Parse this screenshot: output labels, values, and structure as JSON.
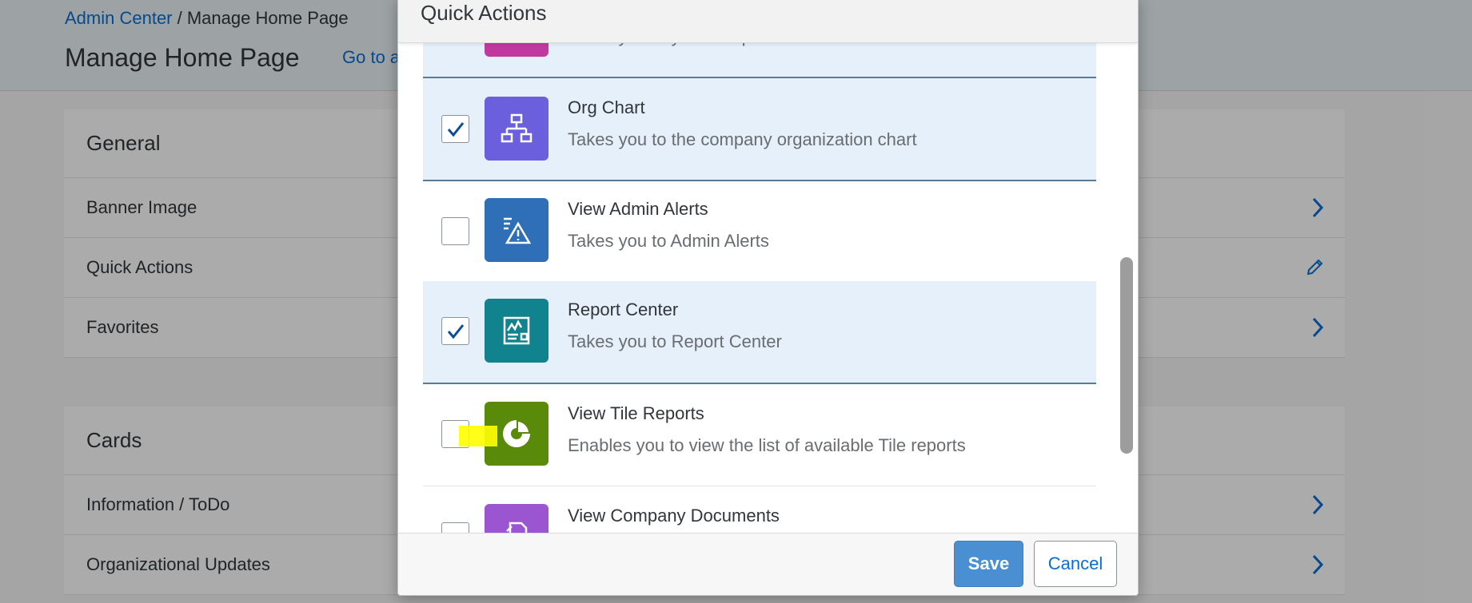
{
  "background": {
    "breadcrumb": {
      "root": "Admin Center",
      "separator": " / ",
      "current": "Manage Home Page"
    },
    "page_title": "Manage Home Page",
    "goto_link": "Go to a",
    "general": {
      "title": "General",
      "rows": [
        {
          "label": "Banner Image",
          "icon": "chevron-right-icon"
        },
        {
          "label": "Quick Actions",
          "icon": "pencil-icon"
        },
        {
          "label": "Favorites",
          "icon": "chevron-right-icon"
        }
      ]
    },
    "cards": {
      "title": "Cards",
      "rows": [
        {
          "label": "Information / ToDo",
          "icon": "chevron-right-icon"
        },
        {
          "label": "Organizational Updates",
          "icon": "chevron-right-icon"
        }
      ]
    }
  },
  "dialog": {
    "title": "Quick Actions",
    "items": [
      {
        "title": "",
        "description": "Takes you to your People Profile",
        "checked": true,
        "icon": "people-profile-icon",
        "color": "#c0399f"
      },
      {
        "title": "Org Chart",
        "description": "Takes you to the company organization chart",
        "checked": true,
        "icon": "org-chart-icon",
        "color": "#6c5fdd"
      },
      {
        "title": "View Admin Alerts",
        "description": "Takes you to Admin Alerts",
        "checked": false,
        "icon": "admin-alerts-icon",
        "color": "#2f6fb7"
      },
      {
        "title": "Report Center",
        "description": "Takes you to Report Center",
        "checked": true,
        "icon": "report-center-icon",
        "color": "#11838f"
      },
      {
        "title": "View Tile Reports",
        "description": "Enables you to view the list of available Tile reports",
        "checked": false,
        "icon": "tile-reports-icon",
        "color": "#5a8a0a"
      },
      {
        "title": "View Company Documents",
        "description": "",
        "checked": false,
        "icon": "company-documents-icon",
        "color": "#9b55d0"
      }
    ],
    "footer": {
      "save_label": "Save",
      "cancel_label": "Cancel"
    }
  },
  "colors": {
    "accent": "#0a6ed1",
    "save_button": "#4a8fd1",
    "highlight": "#ffff00"
  }
}
